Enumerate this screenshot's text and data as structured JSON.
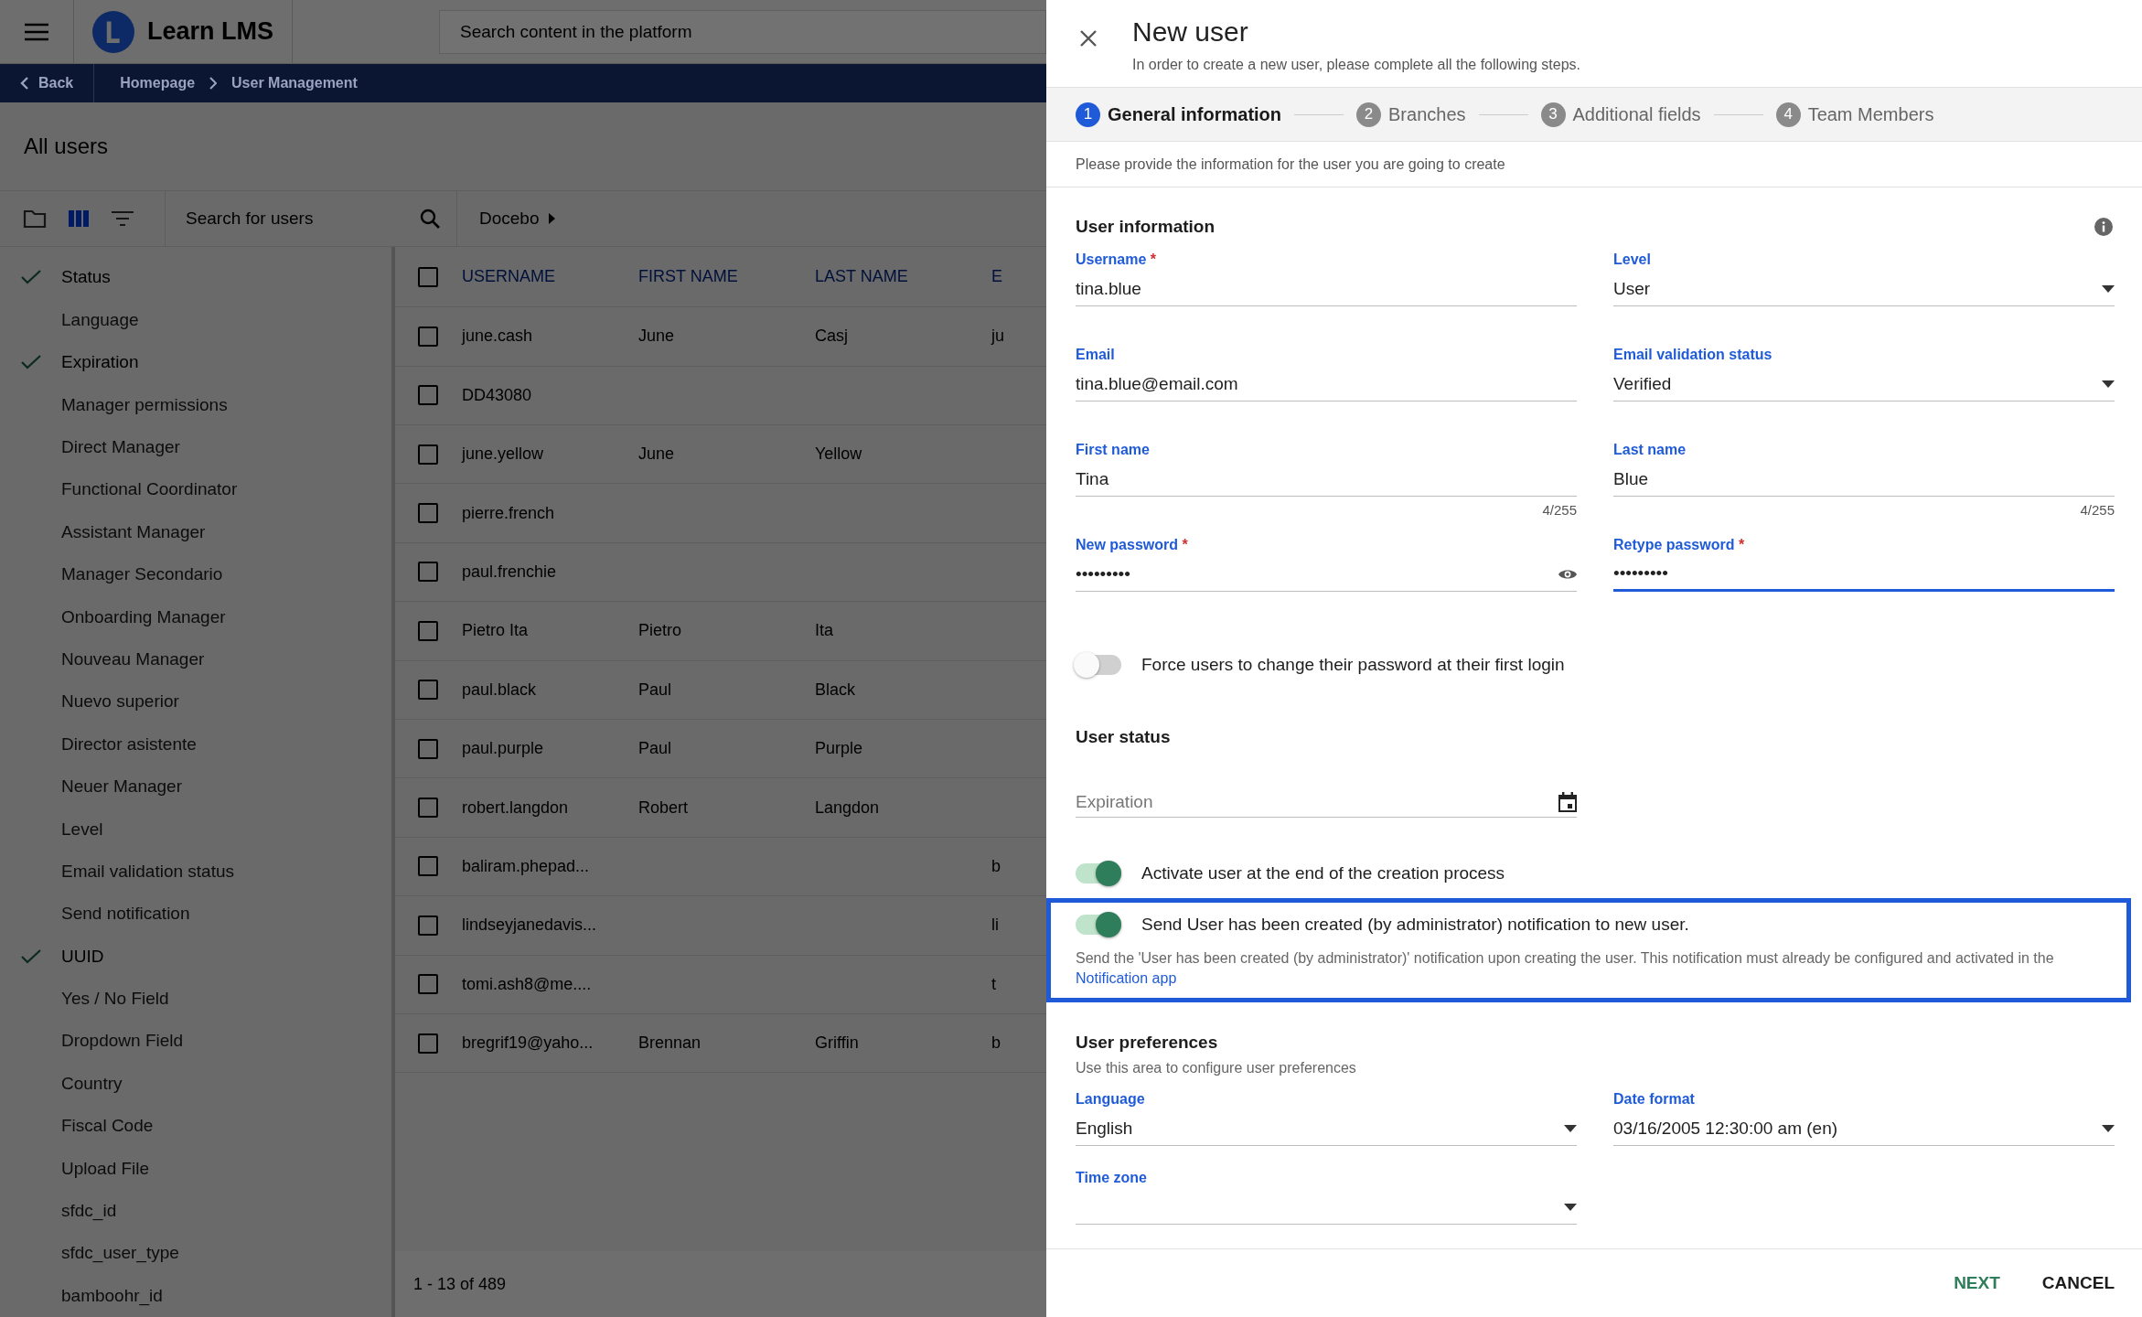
{
  "header": {
    "app_name": "Learn LMS",
    "search": {
      "placeholder": "Search content in the platform"
    }
  },
  "breadcrumb": {
    "back": "Back",
    "items": [
      "Homepage",
      "User Management"
    ]
  },
  "page_title": "All users",
  "toolbar": {
    "views": [
      {
        "kind": "folder",
        "selected": false
      },
      {
        "kind": "columns",
        "selected": true
      },
      {
        "kind": "filter",
        "selected": false
      }
    ],
    "search": {
      "placeholder": "Search for users"
    }
  },
  "branch_path": "Docebo",
  "column_menu": [
    {
      "label": "Status",
      "checked": true
    },
    {
      "label": "Language",
      "checked": false
    },
    {
      "label": "Expiration",
      "checked": true
    },
    {
      "label": "Manager permissions",
      "checked": false
    },
    {
      "label": "Direct Manager",
      "checked": false
    },
    {
      "label": "Functional Coordinator",
      "checked": false
    },
    {
      "label": "Assistant Manager",
      "checked": false
    },
    {
      "label": "Manager Secondario",
      "checked": false
    },
    {
      "label": "Onboarding Manager",
      "checked": false
    },
    {
      "label": "Nouveau Manager",
      "checked": false
    },
    {
      "label": "Nuevo superior",
      "checked": false
    },
    {
      "label": "Director asistente",
      "checked": false
    },
    {
      "label": "Neuer Manager",
      "checked": false
    },
    {
      "label": "Level",
      "checked": false
    },
    {
      "label": "Email validation status",
      "checked": false
    },
    {
      "label": "Send notification",
      "checked": false
    },
    {
      "label": "UUID",
      "checked": true
    },
    {
      "label": "Yes / No Field",
      "checked": false
    },
    {
      "label": "Dropdown Field",
      "checked": false
    },
    {
      "label": "Country",
      "checked": false
    },
    {
      "label": "Fiscal Code",
      "checked": false
    },
    {
      "label": "Upload File",
      "checked": false
    },
    {
      "label": "sfdc_id",
      "checked": false
    },
    {
      "label": "sfdc_user_type",
      "checked": false
    },
    {
      "label": "bamboohr_id",
      "checked": false
    }
  ],
  "table": {
    "select_all_checked": false,
    "columns": [
      "USERNAME",
      "FIRST NAME",
      "LAST NAME",
      "E"
    ],
    "rows": [
      {
        "checked": false,
        "username": "june.cash",
        "first_name": "June",
        "last_name": "Casj",
        "column_4": "ju"
      },
      {
        "checked": false,
        "username": "DD43080"
      },
      {
        "checked": false,
        "username": "june.yellow",
        "first_name": "June",
        "last_name": "Yellow"
      },
      {
        "checked": false,
        "username": "pierre.french"
      },
      {
        "checked": false,
        "username": "paul.frenchie"
      },
      {
        "checked": false,
        "username": "Pietro Ita",
        "first_name": "Pietro",
        "last_name": "Ita"
      },
      {
        "checked": false,
        "username": "paul.black",
        "first_name": "Paul",
        "last_name": "Black"
      },
      {
        "checked": false,
        "username": "paul.purple",
        "first_name": "Paul",
        "last_name": "Purple"
      },
      {
        "checked": false,
        "username": "robert.langdon",
        "first_name": "Robert",
        "last_name": "Langdon"
      },
      {
        "checked": false,
        "username": "baliram.phepad...",
        "column_4": "b"
      },
      {
        "checked": false,
        "username": "lindseyjanedavis...",
        "column_4": "li"
      },
      {
        "checked": false,
        "username": "tomi.ash8@me....",
        "column_4": "t"
      },
      {
        "checked": false,
        "username": "bregrif19@yaho...",
        "first_name": "Brennan",
        "last_name": "Griffin",
        "column_4": "b"
      }
    ]
  },
  "pagination": "1 - 13 of 489",
  "dialog": {
    "title": "New user",
    "subtitle": "In order to create a new user, please complete all the following steps.",
    "steps": [
      {
        "number": "1",
        "label": "General information",
        "selected": true
      },
      {
        "number": "2",
        "label": "Branches",
        "selected": false
      },
      {
        "number": "3",
        "label": "Additional fields",
        "selected": false
      },
      {
        "number": "4",
        "label": "Team Members",
        "selected": false
      }
    ],
    "hint": "Please provide the information for the user you are going to create",
    "user_information": {
      "title": "User information",
      "fields": [
        {
          "kind": "text",
          "label": "Username",
          "required_mark": "*",
          "value": "tina.blue",
          "focused": false
        },
        {
          "kind": "select",
          "label": "Level",
          "value": "User",
          "focused": false
        },
        {
          "kind": "text",
          "label": "Email",
          "value": "tina.blue@email.com",
          "focused": false
        },
        {
          "kind": "select",
          "label": "Email validation status",
          "value": "Verified",
          "focused": false
        },
        {
          "kind": "text",
          "label": "First name",
          "value": "Tina",
          "counter": "4/255",
          "focused": false
        },
        {
          "kind": "text",
          "label": "Last name",
          "value": "Blue",
          "counter": "4/255",
          "focused": false
        },
        {
          "kind": "password",
          "label": "New password",
          "required_mark": "*",
          "value": "•••••••••",
          "revealable": true,
          "focused": false
        },
        {
          "kind": "password",
          "label": "Retype password",
          "required_mark": "*",
          "value": "•••••••••",
          "revealable": false,
          "focused": true
        }
      ],
      "force_toggle": {
        "label": "Force users to change their password at their first login",
        "on": false
      }
    },
    "user_status": {
      "title": "User status",
      "expiration": {
        "placeholder": "Expiration"
      },
      "toggles": [
        {
          "label": "Activate user at the end of the creation process",
          "on": true,
          "highlighted": false
        },
        {
          "label": "Send User has been created (by administrator) notification to new user.",
          "on": true,
          "highlighted": true,
          "description": "Send the 'User has been created (by administrator)' notification upon creating the user. This notification must already be configured and activated in the ",
          "link": "Notification app"
        }
      ]
    },
    "user_preferences": {
      "title": "User preferences",
      "subtitle": "Use this area to configure user preferences",
      "fields": [
        {
          "kind": "select",
          "label": "Language",
          "value": "English"
        },
        {
          "kind": "select",
          "label": "Date format",
          "value": "03/16/2005 12:30:00 am (en)"
        },
        {
          "kind": "select",
          "label": "Time zone"
        }
      ]
    },
    "actions": [
      {
        "kind": "primary",
        "label": "NEXT"
      },
      {
        "kind": "secondary",
        "label": "CANCEL"
      }
    ]
  }
}
